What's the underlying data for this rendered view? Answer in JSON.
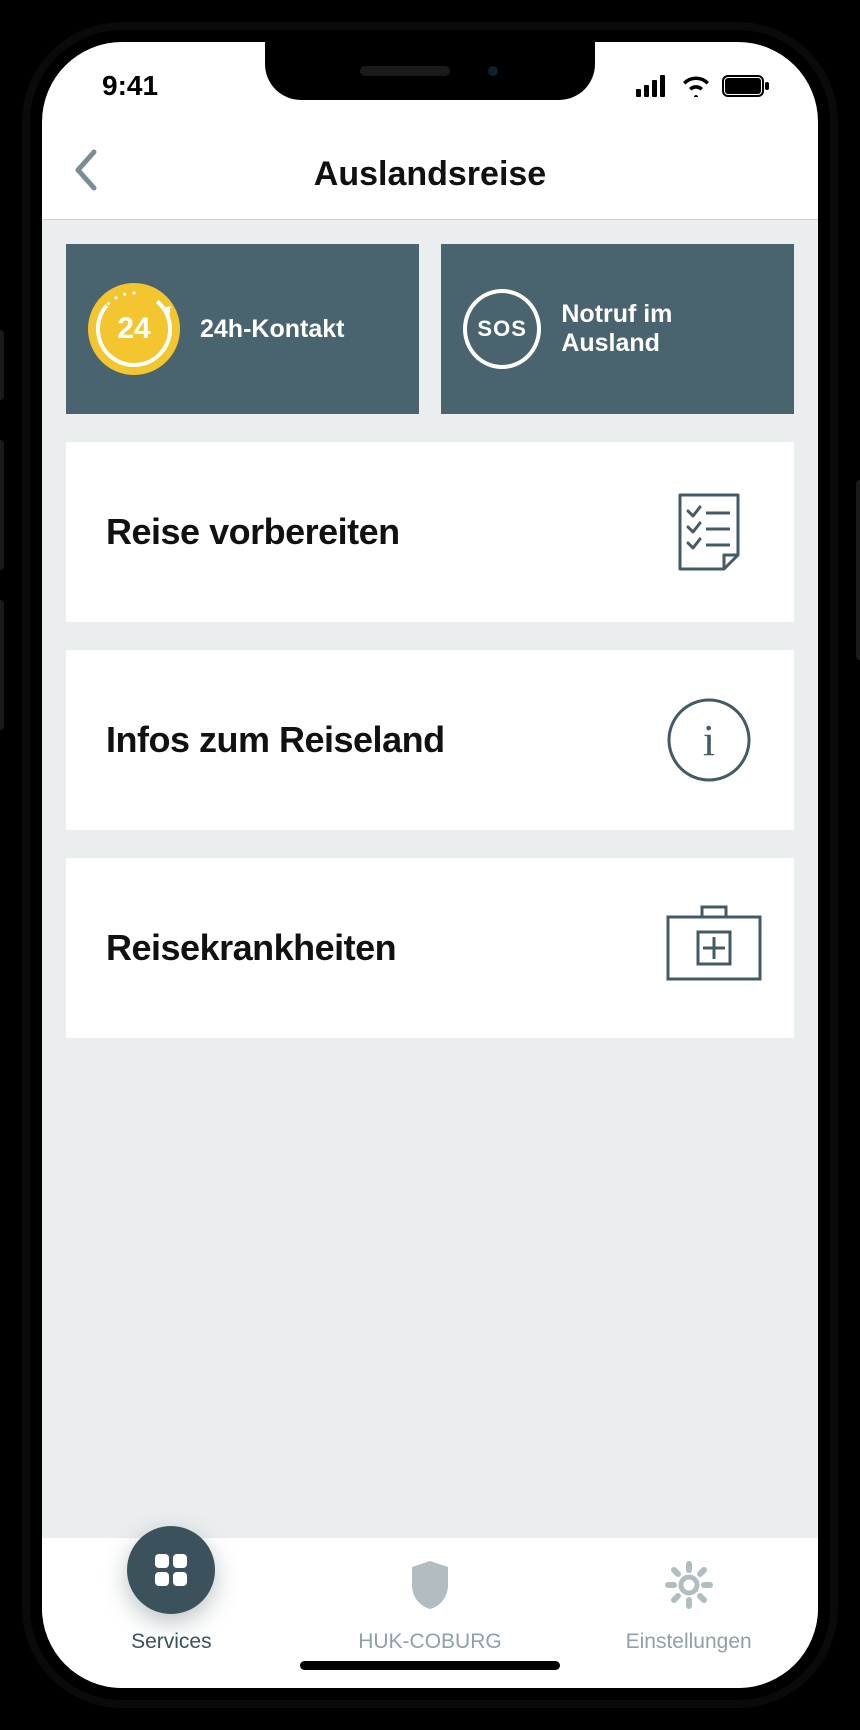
{
  "status": {
    "time": "9:41"
  },
  "nav": {
    "title": "Auslandsreise"
  },
  "tiles": {
    "contact": {
      "label": "24h-Kontakt",
      "badge": "24"
    },
    "sos": {
      "label": "Notruf im Ausland",
      "badge": "SOS"
    }
  },
  "cards": [
    {
      "label": "Reise vorbereiten"
    },
    {
      "label": "Infos zum Reiseland"
    },
    {
      "label": "Reisekrankheiten"
    }
  ],
  "tabs": {
    "services": "Services",
    "huk": "HUK-COBURG",
    "settings": "Einstellungen"
  }
}
